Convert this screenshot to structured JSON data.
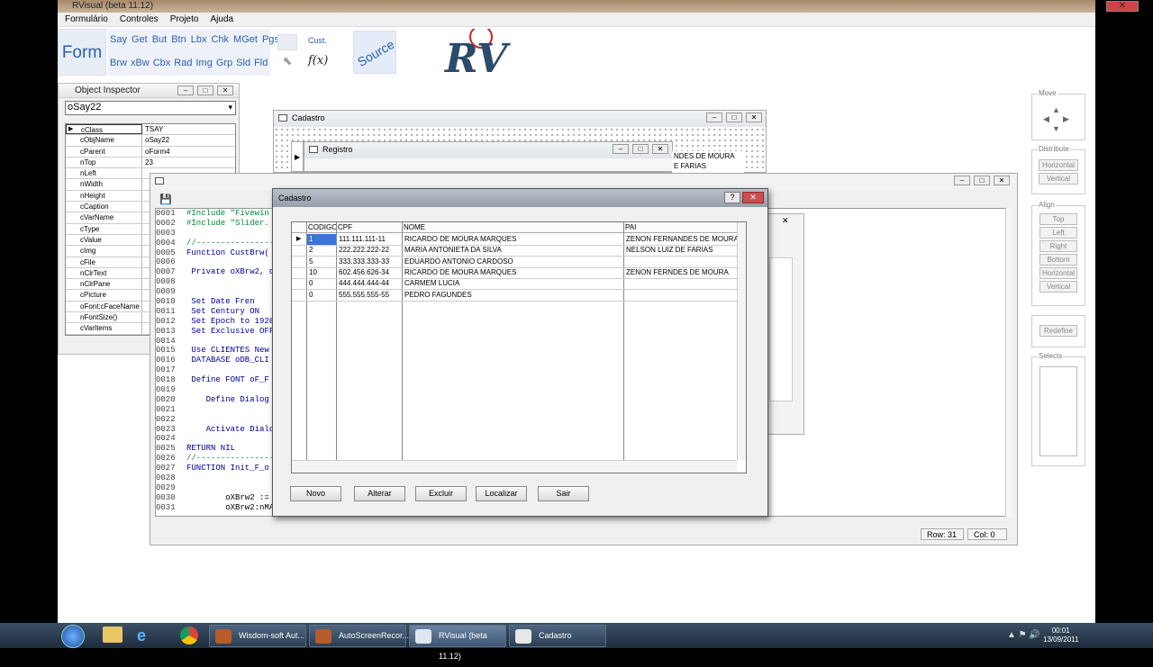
{
  "app": {
    "title": "RVisual (beta 11.12)",
    "menu": [
      "Formulário",
      "Controles",
      "Projeto",
      "Ajuda"
    ]
  },
  "toolbar": {
    "form": "Form",
    "row1": [
      "Say",
      "Get",
      "But",
      "Btn",
      "Lbx",
      "Chk",
      "MGet",
      "Pgs"
    ],
    "row2": [
      "Brw",
      "xBw",
      "Cbx",
      "Rad",
      "Img",
      "Grp",
      "Sld",
      "Fld"
    ],
    "cust": "Cust.",
    "fx": "f(x)",
    "source": "Source",
    "logo": "RV"
  },
  "object_inspector": {
    "title": "Object Inspector",
    "selected": "oSay22",
    "props": [
      [
        "cClass",
        "TSAY"
      ],
      [
        "cObjName",
        "oSay22"
      ],
      [
        "cParent",
        "oForm4"
      ],
      [
        "nTop",
        "23"
      ],
      [
        "nLeft",
        ""
      ],
      [
        "nWidth",
        ""
      ],
      [
        "nHeight",
        ""
      ],
      [
        "cCaption",
        ""
      ],
      [
        "cVarName",
        ""
      ],
      [
        "cType",
        ""
      ],
      [
        "cValue",
        ""
      ],
      [
        "cImg",
        ""
      ],
      [
        "cFile",
        ""
      ],
      [
        "nClrText",
        ""
      ],
      [
        "nClrPane",
        ""
      ],
      [
        "cPicture",
        ""
      ],
      [
        "oFont:cFaceName",
        ""
      ],
      [
        "nFontSize()",
        ""
      ],
      [
        "cVarItems",
        ""
      ]
    ]
  },
  "bg_windows": {
    "cadastro": "Cadastro",
    "registro": "Registro",
    "names": [
      "NDES DE MOURA",
      "E FARIAS"
    ]
  },
  "editor": {
    "lines": [
      [
        "0001",
        "#Include \"Fivewin"
      ],
      [
        "0002",
        "#Include \"Slider."
      ],
      [
        "0003",
        ""
      ],
      [
        "0004",
        "//-----------------"
      ],
      [
        "0005",
        "Function CustBrw("
      ],
      [
        "0006",
        ""
      ],
      [
        "0007",
        " Private oXBrw2, o"
      ],
      [
        "0008",
        ""
      ],
      [
        "0009",
        ""
      ],
      [
        "0010",
        " Set Date Fren"
      ],
      [
        "0011",
        " Set Century ON"
      ],
      [
        "0012",
        " Set Epoch to 1920"
      ],
      [
        "0013",
        " Set Exclusive OFF"
      ],
      [
        "0014",
        ""
      ],
      [
        "0015",
        " Use CLIENTES New"
      ],
      [
        "0016",
        " DATABASE oDB_CLI"
      ],
      [
        "0017",
        ""
      ],
      [
        "0018",
        " Define FONT oF_F"
      ],
      [
        "0019",
        ""
      ],
      [
        "0020",
        "    Define Dialog"
      ],
      [
        "0021",
        ""
      ],
      [
        "0022",
        ""
      ],
      [
        "0023",
        "    Activate Dialo"
      ],
      [
        "0024",
        ""
      ],
      [
        "0025",
        "RETURN NIL"
      ],
      [
        "0026",
        "//-----------------"
      ],
      [
        "0027",
        "FUNCTION Init_F_o"
      ],
      [
        "0028",
        ""
      ],
      [
        "0029",
        ""
      ],
      [
        "0030",
        "        oXBrw2 :="
      ],
      [
        "0031",
        "        oXBrw2:nMA"
      ]
    ],
    "row": "Row: 31",
    "col": "Col: 0"
  },
  "dialog": {
    "title": "Cadastro",
    "help": "?",
    "columns": [
      "CODIGO",
      "CPF",
      "NOME",
      "PAI"
    ],
    "rows": [
      [
        "1",
        "111.111.111-11",
        "RICARDO DE MOURA MARQUES",
        "ZENON FERNANDES DE MOURA"
      ],
      [
        "2",
        "222.222.222-22",
        "MARIA ANTONIETA DA SILVA",
        "NELSON LUIZ DE FARIAS"
      ],
      [
        "5",
        "333.333.333-33",
        "EDUARDO ANTONIO CARDOSO",
        ""
      ],
      [
        "10",
        "602.456.626-34",
        "RICARDO DE MOURA MARQUES",
        "ZENON FERNDES DE MOURA"
      ],
      [
        "0",
        "444.444.444-44",
        "CARMEM LUCIA",
        ""
      ],
      [
        "0",
        "555.555.555-55",
        "PEDRO FAGUNDES",
        ""
      ]
    ],
    "buttons": [
      "Novo",
      "Alterar",
      "Excluir",
      "Localizar",
      "Sair"
    ]
  },
  "right_panel": {
    "move": "Move",
    "distribute": "Distribute",
    "dist_btns": [
      "Horizontal",
      "Vertical"
    ],
    "align": "Align",
    "align_btns": [
      "Top",
      "Left",
      "Right",
      "Bottom",
      "Horizontal",
      "Vertical"
    ],
    "redefine": "Redefine",
    "selects": "Selects"
  },
  "taskbar": {
    "items": [
      "Wisdom-soft Aut...",
      "AutoScreenRecor...",
      "RVisual (beta 11.12)",
      "Cadastro"
    ],
    "time": "00:01",
    "date": "13/09/2011"
  }
}
